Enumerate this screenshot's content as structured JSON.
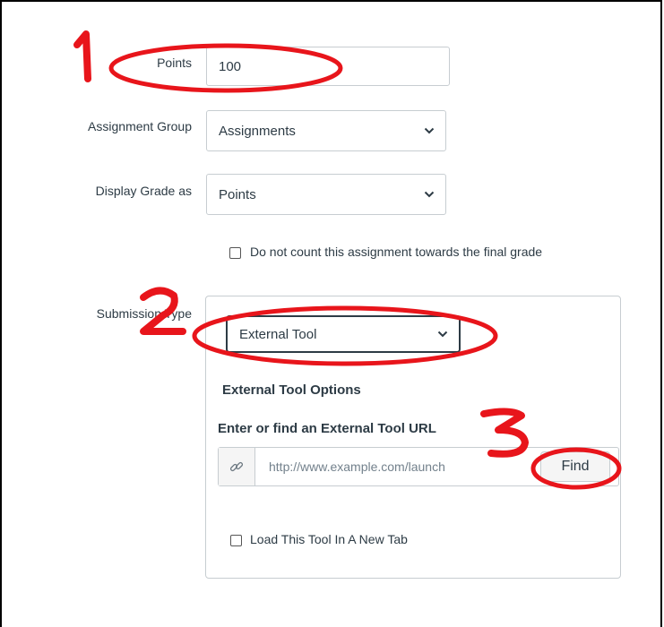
{
  "form": {
    "points_label": "Points",
    "points_value": "100",
    "assignment_group_label": "Assignment Group",
    "assignment_group_value": "Assignments",
    "display_grade_label": "Display Grade as",
    "display_grade_value": "Points",
    "exclude_checkbox_label": "Do not count this assignment towards the final grade",
    "exclude_checkbox_checked": false,
    "submission_type_label": "Submission Type",
    "submission_type_value": "External Tool"
  },
  "external_tool": {
    "options_heading": "External Tool Options",
    "url_heading": "Enter or find an External Tool URL",
    "url_placeholder": "http://www.example.com/launch",
    "find_button": "Find",
    "new_tab_label": "Load This Tool In A New Tab",
    "new_tab_checked": false
  },
  "annotations": {
    "color": "#e8151b",
    "numbers": [
      "1",
      "2",
      "3"
    ]
  },
  "icons": {
    "link": "link-icon",
    "chevron": "chevron-down-icon"
  }
}
